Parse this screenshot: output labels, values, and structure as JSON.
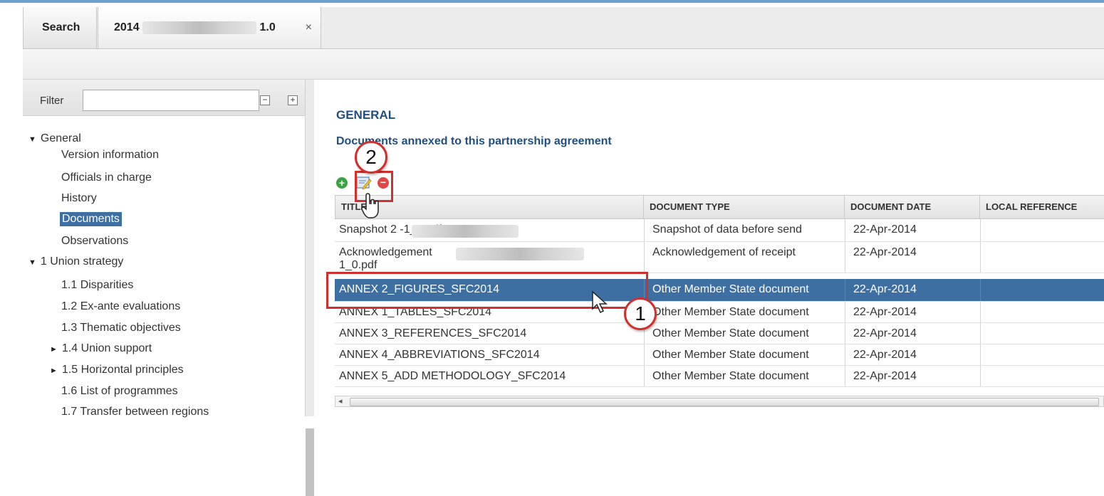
{
  "tabs": {
    "search_label": "Search",
    "doc_prefix": "2014",
    "doc_suffix": "1.0",
    "close_glyph": "×"
  },
  "sidebar": {
    "filter_label": "Filter",
    "filter_value": "",
    "collapse_glyph": "−",
    "expand_glyph": "+",
    "items": [
      {
        "label": "General",
        "arrow": "▼"
      },
      {
        "label": "Version information"
      },
      {
        "label": "Officials in charge"
      },
      {
        "label": "History"
      },
      {
        "label": "Documents"
      },
      {
        "label": "Observations"
      },
      {
        "label": "1 Union strategy",
        "arrow": "▼"
      },
      {
        "label": "1.1 Disparities"
      },
      {
        "label": "1.2 Ex-ante evaluations"
      },
      {
        "label": "1.3 Thematic objectives"
      },
      {
        "label": "1.4 Union support",
        "arrow": "►"
      },
      {
        "label": "1.5 Horizontal principles",
        "arrow": "►"
      },
      {
        "label": "1.6 List of programmes"
      },
      {
        "label": "1.7 Transfer between regions"
      }
    ]
  },
  "main": {
    "section_title": "GENERAL",
    "section_subtitle": "Documents annexed to this partnership agreement",
    "columns": [
      "TITLE",
      "DOCUMENT TYPE",
      "DOCUMENT DATE",
      "LOCAL REFERENCE"
    ],
    "rows": [
      {
        "title": "Snapshot 2                              -1_0.pdf",
        "type": "Snapshot of data before send",
        "date": "22-Apr-2014",
        "ref": ""
      },
      {
        "title": "Acknowledgement",
        "title2": "1_0.pdf",
        "type": "Acknowledgement of receipt",
        "date": "22-Apr-2014",
        "ref": ""
      },
      {
        "title": "ANNEX 2_FIGURES_SFC2014",
        "type": "Other Member State document",
        "date": "22-Apr-2014",
        "ref": ""
      },
      {
        "title": "ANNEX 1_TABLES_SFC2014",
        "type": "Other Member State document",
        "date": "22-Apr-2014",
        "ref": ""
      },
      {
        "title": "ANNEX 3_REFERENCES_SFC2014",
        "type": "Other Member State document",
        "date": "22-Apr-2014",
        "ref": ""
      },
      {
        "title": "ANNEX 4_ABBREVIATIONS_SFC2014",
        "type": "Other Member State document",
        "date": "22-Apr-2014",
        "ref": ""
      },
      {
        "title": "ANNEX 5_ADD METHODOLOGY_SFC2014",
        "type": "Other Member State document",
        "date": "22-Apr-2014",
        "ref": ""
      }
    ],
    "selected_row_index": 2,
    "scroll_glyph": "◂"
  },
  "callouts": {
    "step1": "1",
    "step2": "2"
  },
  "colors": {
    "accent": "#1f4f82",
    "selection": "#3e6fa3",
    "callout": "#d0312d"
  }
}
